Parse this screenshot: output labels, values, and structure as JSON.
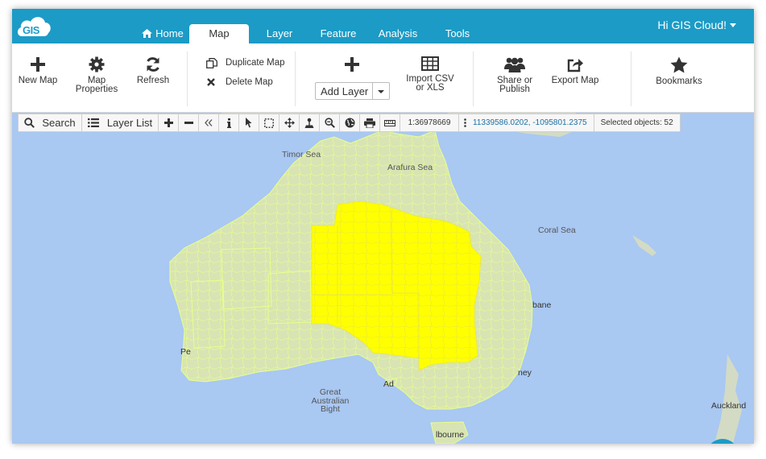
{
  "app": {
    "logo_text": "GIS"
  },
  "nav": {
    "tabs": [
      {
        "label": "Home",
        "icon": "home-icon"
      },
      {
        "label": "Map",
        "active": true
      },
      {
        "label": "Layer"
      },
      {
        "label": "Feature"
      },
      {
        "label": "Analysis"
      },
      {
        "label": "Tools"
      }
    ],
    "greeting": "Hi GIS Cloud!"
  },
  "ribbon": {
    "new_map": "New Map",
    "map_properties_1": "Map",
    "map_properties_2": "Properties",
    "refresh": "Refresh",
    "duplicate_map": "Duplicate Map",
    "delete_map": "Delete Map",
    "add_layer": "Add Layer",
    "import_1": "Import CSV",
    "import_2": "or XLS",
    "share_1": "Share or",
    "share_2": "Publish",
    "export_map": "Export Map",
    "bookmarks": "Bookmarks"
  },
  "map_toolbar": {
    "search": "Search",
    "layer_list": "Layer List",
    "scale": "1:36978669",
    "coordinates": "11339586.0202, -1095801.2375",
    "selected": "Selected objects: 52"
  },
  "map_labels": {
    "timor_sea": "Timor Sea",
    "arafura_sea": "Arafura Sea",
    "coral_sea": "Coral Sea",
    "brisbane_partial": "bane",
    "sydney_partial": "ney",
    "perth_partial": "Pe",
    "adelaide_partial": "Ad",
    "melbourne_partial": "lbourne",
    "bight_1": "Great",
    "bight_2": "Australian",
    "bight_3": "Bight",
    "auckland": "Auckland"
  },
  "colors": {
    "header": "#1b9bc6",
    "ocean": "#a9c8f2",
    "land": "#d8e4b4",
    "boundary": "#e8ff8a",
    "selection": "#ffff00"
  }
}
